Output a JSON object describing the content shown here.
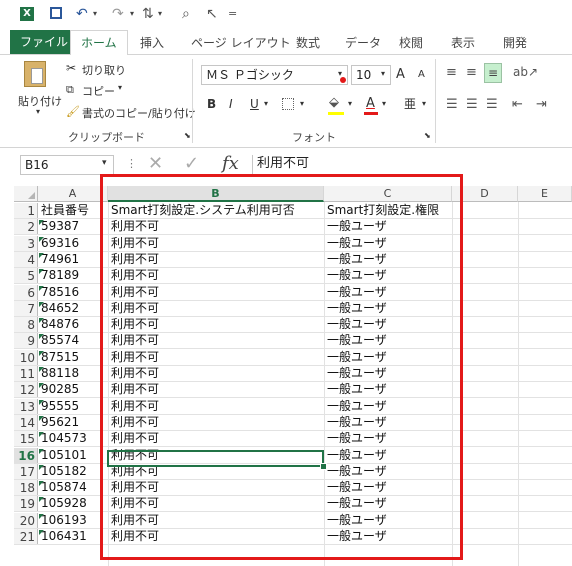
{
  "qat": {
    "excel_icon": "excel-logo-icon",
    "save_icon": "save-icon",
    "undo_icon": "undo-icon",
    "redo_icon": "redo-icon",
    "more": "="
  },
  "tabs": [
    "ファイル",
    "ホーム",
    "挿入",
    "ページ レイアウト",
    "数式",
    "データ",
    "校閲",
    "表示",
    "開発"
  ],
  "ribbon": {
    "clipboard": {
      "paste": "貼り付け",
      "cut": "切り取り",
      "copy": "コピー",
      "format_painter": "書式のコピー/貼り付け",
      "group_label": "クリップボード"
    },
    "font": {
      "font_name": "ＭＳ Ｐゴシック",
      "font_size": "10",
      "bold": "B",
      "italic": "I",
      "underline": "U",
      "font_color": "A",
      "grow": "A",
      "shrink": "A",
      "group_label": "フォント"
    }
  },
  "formula_bar": {
    "name_box": "B16",
    "fx": "fx",
    "value": "利用不可"
  },
  "columns": [
    "A",
    "B",
    "C",
    "D",
    "E"
  ],
  "selected_column": "B",
  "selected_row": "16",
  "rows": [
    {
      "n": "1",
      "a": "社員番号",
      "b": "Smart打刻設定.システム利用可否",
      "c": "Smart打刻設定.権限"
    },
    {
      "n": "2",
      "a": "59387",
      "b": "利用不可",
      "c": "一般ユーザ"
    },
    {
      "n": "3",
      "a": "69316",
      "b": "利用不可",
      "c": "一般ユーザ"
    },
    {
      "n": "4",
      "a": "74961",
      "b": "利用不可",
      "c": "一般ユーザ"
    },
    {
      "n": "5",
      "a": "78189",
      "b": "利用不可",
      "c": "一般ユーザ"
    },
    {
      "n": "6",
      "a": "78516",
      "b": "利用不可",
      "c": "一般ユーザ"
    },
    {
      "n": "7",
      "a": "84652",
      "b": "利用不可",
      "c": "一般ユーザ"
    },
    {
      "n": "8",
      "a": "84876",
      "b": "利用不可",
      "c": "一般ユーザ"
    },
    {
      "n": "9",
      "a": "85574",
      "b": "利用不可",
      "c": "一般ユーザ"
    },
    {
      "n": "10",
      "a": "87515",
      "b": "利用不可",
      "c": "一般ユーザ"
    },
    {
      "n": "11",
      "a": "88118",
      "b": "利用不可",
      "c": "一般ユーザ"
    },
    {
      "n": "12",
      "a": "90285",
      "b": "利用不可",
      "c": "一般ユーザ"
    },
    {
      "n": "13",
      "a": "95555",
      "b": "利用不可",
      "c": "一般ユーザ"
    },
    {
      "n": "14",
      "a": "95621",
      "b": "利用不可",
      "c": "一般ユーザ"
    },
    {
      "n": "15",
      "a": "104573",
      "b": "利用不可",
      "c": "一般ユーザ"
    },
    {
      "n": "16",
      "a": "105101",
      "b": "利用不可",
      "c": "一般ユーザ"
    },
    {
      "n": "17",
      "a": "105182",
      "b": "利用不可",
      "c": "一般ユーザ"
    },
    {
      "n": "18",
      "a": "105874",
      "b": "利用不可",
      "c": "一般ユーザ"
    },
    {
      "n": "19",
      "a": "105928",
      "b": "利用不可",
      "c": "一般ユーザ"
    },
    {
      "n": "20",
      "a": "106193",
      "b": "利用不可",
      "c": "一般ユーザ"
    },
    {
      "n": "21",
      "a": "106431",
      "b": "利用不可",
      "c": "一般ユーザ"
    }
  ],
  "colors": {
    "accent": "#217346",
    "highlight_box": "#e31919"
  }
}
